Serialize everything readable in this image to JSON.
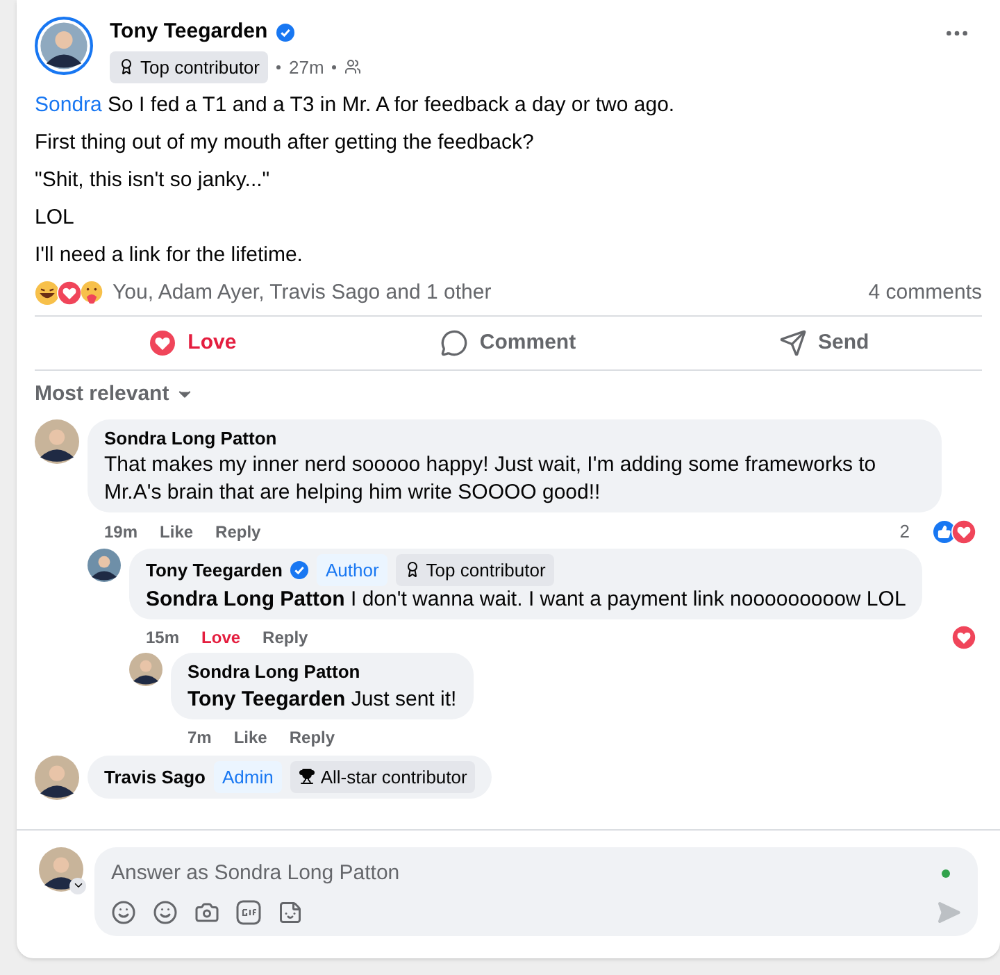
{
  "post": {
    "author": "Tony Teegarden",
    "verified": true,
    "badge": "Top contributor",
    "time": "27m",
    "lines": [
      {
        "mention": "Sondra",
        "text": "So I fed a T1 and a T3 in Mr. A for feedback a day or two ago."
      },
      {
        "text": "First thing out of my mouth after getting the feedback?"
      },
      {
        "text": "\"Shit, this isn't so janky...\""
      },
      {
        "text": "LOL"
      },
      {
        "text": "I'll need a link for the lifetime."
      }
    ],
    "reactions": [
      {
        "kind": "haha"
      },
      {
        "kind": "love"
      },
      {
        "kind": "care"
      }
    ],
    "reacted_by": "You, Adam Ayer, Travis Sago and 1 other",
    "comment_count": "4 comments"
  },
  "actions": [
    {
      "kind": "love",
      "label": "Love",
      "selected": true
    },
    {
      "kind": "comment",
      "label": "Comment",
      "selected": false
    },
    {
      "kind": "send",
      "label": "Send",
      "selected": false
    }
  ],
  "sort": "Most relevant",
  "comments": [
    {
      "name": "Sondra Long Patton",
      "verified": false,
      "text": "That makes my inner nerd sooooo happy! Just wait, I'm adding some frameworks to Mr.A's brain that are helping him write SOOOO good!!",
      "time": "19m",
      "reaction": {
        "label": "Like",
        "selected": false
      },
      "reply": "Reply",
      "reaction_count": "2",
      "reactions": [
        {
          "kind": "like"
        },
        {
          "kind": "love"
        }
      ],
      "children": [
        {
          "name": "Tony Teegarden",
          "verified": true,
          "tags": [
            {
              "kind": "role",
              "label": "Author"
            },
            {
              "kind": "badge",
              "label": "Top contributor"
            }
          ],
          "mention": "Sondra Long Patton",
          "text": "I don't wanna wait. I want a payment link nooooooooow LOL",
          "time": "15m",
          "reaction": {
            "label": "Love",
            "selected": true
          },
          "reply": "Reply",
          "reactions": [
            {
              "kind": "love"
            }
          ],
          "children": [
            {
              "name": "Sondra Long Patton",
              "verified": false,
              "mention": "Tony Teegarden",
              "text": "Just sent it!",
              "time": "7m",
              "reaction": {
                "label": "Like",
                "selected": false
              },
              "reply": "Reply"
            }
          ]
        }
      ]
    },
    {
      "name": "Travis Sago",
      "verified": false,
      "tags": [
        {
          "kind": "role",
          "label": "Admin"
        },
        {
          "kind": "star",
          "label": "All-star contributor"
        }
      ]
    }
  ],
  "composer": {
    "placeholder": "Answer as Sondra Long Patton"
  }
}
